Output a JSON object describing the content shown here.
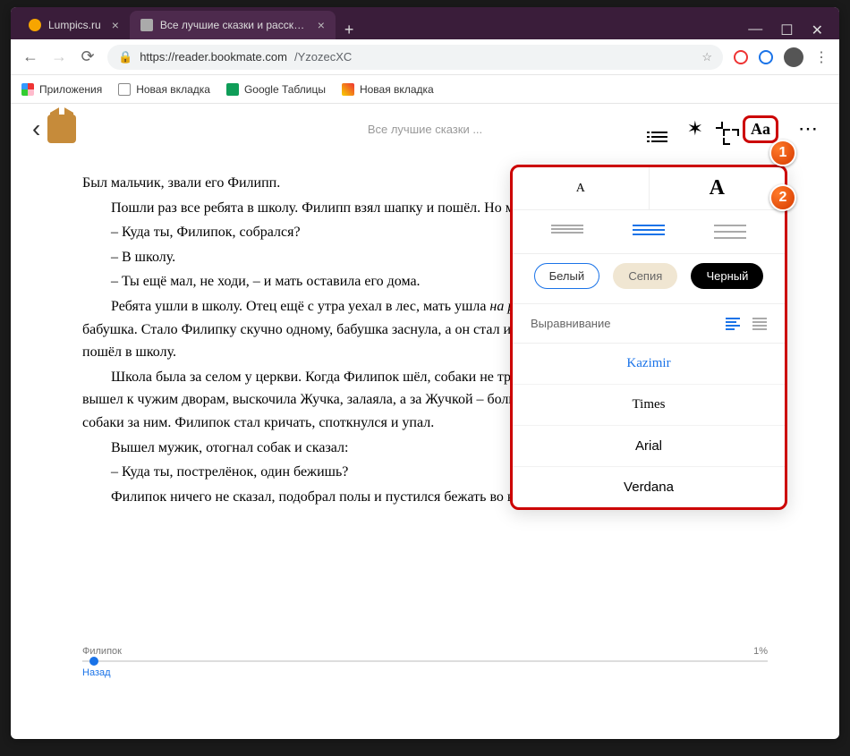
{
  "tabs": {
    "tab1": "Lumpics.ru",
    "tab2": "Все лучшие сказки и рассказы"
  },
  "url": {
    "scheme_host": "https://reader.bookmate.com",
    "path": "/YzozecXC"
  },
  "bookmarks": {
    "apps": "Приложения",
    "newtab1": "Новая вкладка",
    "sheets": "Google Таблицы",
    "newtab2": "Новая вкладка"
  },
  "reader": {
    "book_title": "Все лучшие сказки ...",
    "aa_label": "Aa"
  },
  "content": {
    "p1": "Был мальчик, звали его Филипп.",
    "p2": "Пошли раз все ребята в школу. Филипп взял шапку и пошёл. Но мать сказала ему:",
    "p3": "– Куда ты, Филипок, собрался?",
    "p4": "– В школу.",
    "p5": "– Ты ещё мал, не ходи, – и мать оставила его дома.",
    "p6_a": "Ребята ушли в школу. Отец ещё с утра уехал в лес, мать ушла ",
    "p6_em": "на работу",
    "p6_b": ". Остались в избе Филипок да бабушка. Стало Филипку скучно одному, бабушка заснула, а он стал искать шапку. Нашёл он отцовскую и пошёл в школу.",
    "p7": "Школа была за селом у церкви. Когда Филипок шёл, собаки не трогали его, они его знали. Но когда он вышел к чужим дворам, выскочила Жучка, залаяла, а за Жучкой – большая собака Волчок. Филипок бежать, собаки за ним. Филипок стал кричать, споткнулся и упал.",
    "p8": "Вышел мужик, отогнал собак и сказал:",
    "p9": "– Куда ты, пострелёнок, один бежишь?",
    "p10": "Филипок ничего не сказал, подобрал полы и пустился бежать во весь дух."
  },
  "progress": {
    "chapter": "Филипок",
    "percent": "1%",
    "back": "Назад"
  },
  "popup": {
    "size_small": "A",
    "size_big": "A",
    "theme_white": "Белый",
    "theme_sepia": "Сепия",
    "theme_black": "Черный",
    "align_label": "Выравнивание",
    "font_kazimir": "Kazimir",
    "font_times": "Times",
    "font_arial": "Arial",
    "font_verdana": "Verdana"
  },
  "callouts": {
    "c1": "1",
    "c2": "2"
  }
}
